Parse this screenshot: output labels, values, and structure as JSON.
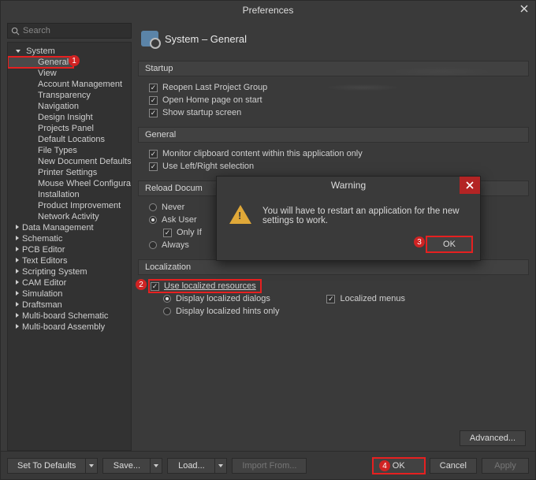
{
  "window": {
    "title": "Preferences"
  },
  "search": {
    "placeholder": "Search"
  },
  "tree": {
    "root": "System",
    "system_children": [
      "General",
      "View",
      "Account Management",
      "Transparency",
      "Navigation",
      "Design Insight",
      "Projects Panel",
      "Default Locations",
      "File Types",
      "New Document Defaults",
      "Printer Settings",
      "Mouse Wheel Configuration",
      "Installation",
      "Product Improvement",
      "Network Activity"
    ],
    "siblings": [
      "Data Management",
      "Schematic",
      "PCB Editor",
      "Text Editors",
      "Scripting System",
      "CAM Editor",
      "Simulation",
      "Draftsman",
      "Multi-board Schematic",
      "Multi-board Assembly"
    ]
  },
  "page": {
    "title": "System – General"
  },
  "sections": {
    "startup": {
      "label": "Startup",
      "items": {
        "reopen": "Reopen Last Project Group",
        "homepage": "Open Home page on start",
        "splash": "Show startup screen"
      }
    },
    "general": {
      "label": "General",
      "items": {
        "clipboard": "Monitor clipboard content within this application only",
        "lrselect": "Use Left/Right selection"
      }
    },
    "reload": {
      "label": "Reload Docum",
      "radios": {
        "never": "Never",
        "ask": "Ask User",
        "always": "Always"
      },
      "onlyif": "Only If"
    },
    "localization": {
      "label": "Localization",
      "use": "Use localized resources",
      "dialogs": "Display localized dialogs",
      "menus": "Localized menus",
      "hints": "Display localized hints only"
    }
  },
  "buttons": {
    "advanced": "Advanced...",
    "defaults": "Set To Defaults",
    "save": "Save...",
    "load": "Load...",
    "import": "Import From...",
    "ok": "OK",
    "cancel": "Cancel",
    "apply": "Apply"
  },
  "modal": {
    "title": "Warning",
    "message": "You will have to restart an application for the new settings to work.",
    "ok": "OK"
  },
  "markers": {
    "m1": "1",
    "m2": "2",
    "m3": "3",
    "m4": "4"
  }
}
